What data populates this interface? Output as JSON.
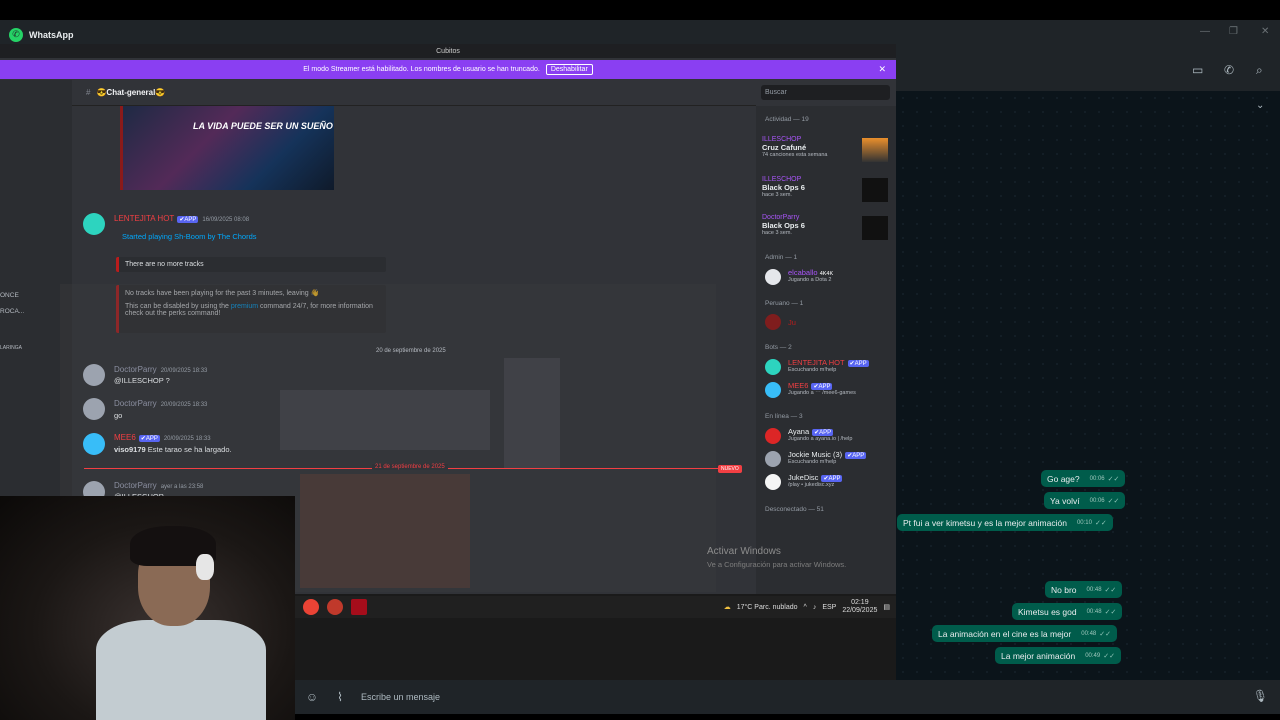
{
  "whatsapp": {
    "title": "WhatsApp",
    "input_placeholder": "Escribe un mensaje",
    "messages": [
      {
        "text": "Go age?",
        "time": "00:06"
      },
      {
        "text": "Ya volví",
        "time": "00:06"
      },
      {
        "text": "Pt fui a ver kimetsu y es la mejor animación",
        "time": "00:10"
      },
      {
        "text": "No bro",
        "time": "00:48"
      },
      {
        "text": "Kimetsu es god",
        "time": "00:48"
      },
      {
        "text": "La animación en el cine es la mejor",
        "time": "00:48"
      },
      {
        "text": "La mejor animación",
        "time": "00:49"
      }
    ]
  },
  "discord": {
    "window_title": "Cubitos",
    "streamer_banner": "El modo Streamer está habilitado. Los nombres de usuario se han truncado.",
    "streamer_button": "Deshabilitar",
    "channel_name": "😎Chat-general😎",
    "search_placeholder": "Buscar",
    "gif_caption": "LA VIDA PUEDE SER UN SUEÑO",
    "msg1": {
      "user": "LENTEJITA HOT",
      "badge": "✔APP",
      "time": "16/09/2025 08:08",
      "activity": "Started playing Sh-Boom by The Chords",
      "embed1": "There are no more tracks",
      "embed2a": "No tracks have been playing for the past 3 minutes, leaving 👋",
      "embed2b_pre": "This can be disabled by using the ",
      "embed2b_link": "premium",
      "embed2b_post": " command 24/7, for more information check out the perks command!"
    },
    "date_sep": "20 de septiembre de 2025",
    "msg2": {
      "user": "DoctorParry",
      "time": "20/09/2025 18:33",
      "text": "@ILLESCHOP ?"
    },
    "msg3": {
      "user": "DoctorParry",
      "time": "20/09/2025 18:33",
      "text": "go"
    },
    "msg4": {
      "user": "MEE6",
      "badge": "✔APP",
      "time": "20/09/2025 18:33",
      "text_bold": "viso9179",
      "text": "Este tarao se ha largado."
    },
    "new_date": "21 de septiembre de 2025",
    "new_tag": "NUEVO",
    "msg5": {
      "user": "DoctorParry",
      "time": "ayer a las 23:58",
      "text": "@ILLESCHOP"
    },
    "sidebar_left": [
      "ONCE",
      "ROCA...",
      "LARINGA"
    ],
    "activity_header": "Actividad — 19",
    "activities": [
      {
        "user": "ILLESCHOP",
        "title": "Cruz Cafuné",
        "sub": "74 canciones esta semana"
      },
      {
        "user": "ILLESCHOP",
        "title": "Black Ops 6",
        "sub": "hace 3 sem."
      },
      {
        "user": "DoctorParry",
        "title": "Black Ops 6",
        "sub": "hace 3 sem."
      }
    ],
    "admin_header": "Admin — 1",
    "admin": {
      "user": "elcaballo",
      "tag": "4K4K",
      "sub": "Jugando a Dota 2"
    },
    "peruano_header": "Peruano — 1",
    "peruano_user": "Ju",
    "bots_header": "Bots — 2",
    "bots": [
      {
        "user": "LENTEJITA HOT",
        "badge": "✔APP",
        "sub": "Escuchando m!help"
      },
      {
        "user": "MEE6",
        "badge": "✔APP",
        "sub": "Jugando a ⋯ /mee6-games"
      }
    ],
    "online_header": "En línea — 3",
    "online": [
      {
        "user": "Ayana",
        "badge": "✔APP",
        "sub": "Jugando a ayana.io | /help"
      },
      {
        "user": "Jockie Music (3)",
        "badge": "✔APP",
        "sub": "Escuchando m!help"
      },
      {
        "user": "JukeDisc",
        "badge": "✔APP",
        "sub": "/play • jukedisc.xyz"
      }
    ],
    "offline_header": "Desconectado — 51"
  },
  "windows_activation": {
    "title": "Activar Windows",
    "sub": "Ve a Configuración para activar Windows."
  },
  "taskbar": {
    "weather": "17°C  Parc. nublado",
    "lang": "ESP",
    "time": "02:19",
    "date": "22/09/2025"
  },
  "colors": {
    "whatsapp_green": "#25d366",
    "bubble": "#005c4b",
    "streamer_banner": "#8a3ff2",
    "discord_bg": "#313338"
  }
}
